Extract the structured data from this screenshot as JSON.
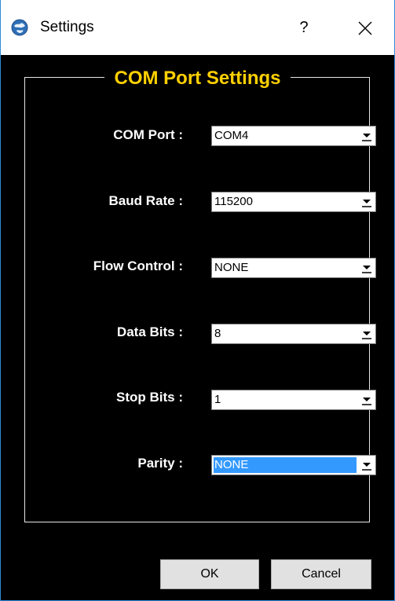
{
  "window": {
    "title": "Settings",
    "help_glyph": "?",
    "close_icon": "close-icon",
    "app_icon": "globe-icon"
  },
  "group": {
    "title": "COM Port Settings"
  },
  "fields": [
    {
      "label": "COM Port :",
      "value": "COM4"
    },
    {
      "label": "Baud Rate :",
      "value": "115200"
    },
    {
      "label": "Flow Control :",
      "value": "NONE"
    },
    {
      "label": "Data Bits :",
      "value": "8"
    },
    {
      "label": "Stop Bits :",
      "value": "1"
    },
    {
      "label": "Parity :",
      "value": "NONE"
    }
  ],
  "buttons": {
    "ok": "OK",
    "cancel": "Cancel"
  },
  "colors": {
    "background": "#000000",
    "group_title": "#ffd000",
    "label": "#ffffff",
    "selection": "#3399ff"
  }
}
